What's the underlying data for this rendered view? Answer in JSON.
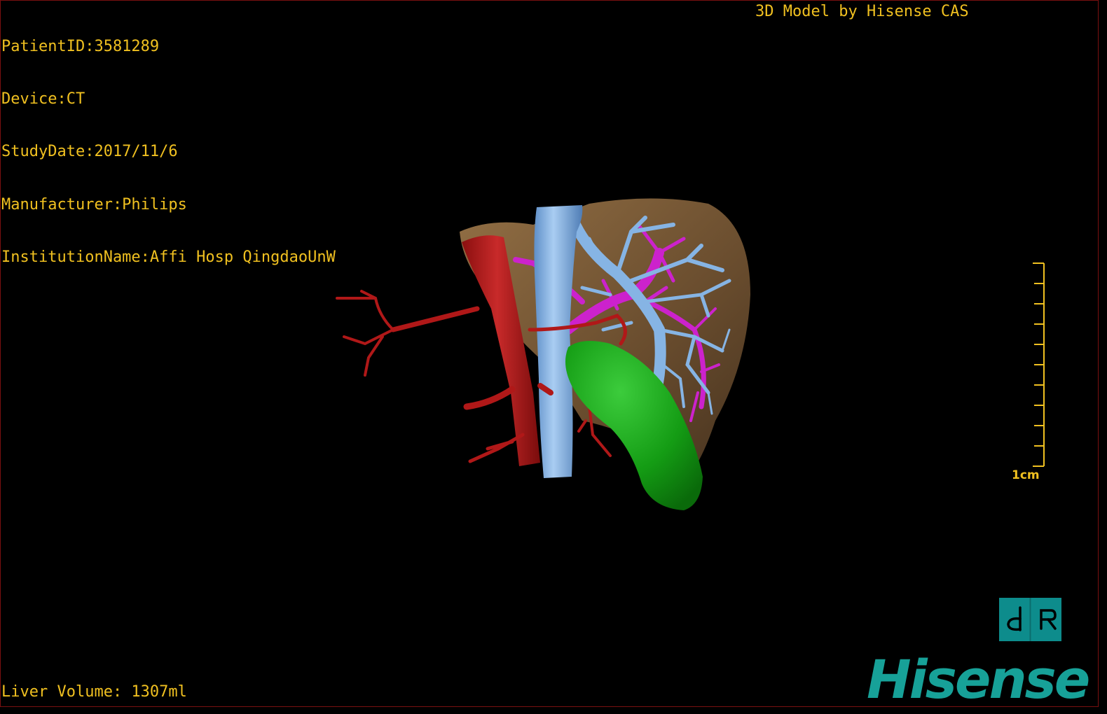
{
  "info": {
    "patient_id": "PatientID:3581289",
    "device": "Device:CT",
    "study_date": "StudyDate:2017/11/6",
    "manufacturer": "Manufacturer:Philips",
    "institution": "InstitutionName:Affi Hosp QingdaoUnW"
  },
  "model_credit": "3D Model by Hisense CAS",
  "liver_volume": "Liver Volume: 1307ml",
  "scale_bar": {
    "label": "1cm",
    "color": "#f0c020"
  },
  "orientation_cube": {
    "left_glyph": "d",
    "right_glyph": "R",
    "color": "#0d8c8c"
  },
  "brand_logo": "Hisense",
  "colors": {
    "overlay_text": "#f0c020",
    "liver": "#7a5a32",
    "portal_vein": "#7aaadf",
    "hepatic_vein": "#cc22cc",
    "artery": "#b01818",
    "tumor": "#14a014",
    "brand": "#17a198"
  }
}
